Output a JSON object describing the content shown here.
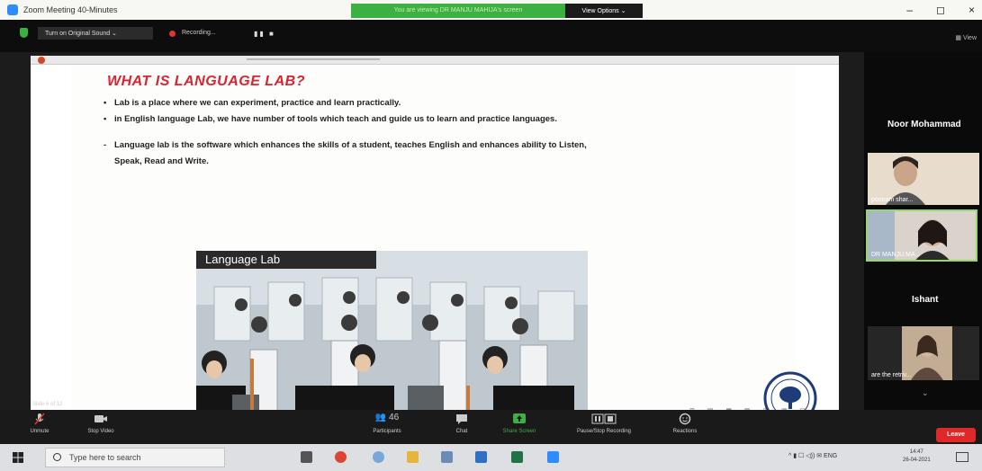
{
  "window": {
    "title": "Zoom Meeting 40-Minutes",
    "share_banner": "You are viewing DR MANJU MAHIJA's screen",
    "view_options": "View Options ⌄",
    "controls": [
      "–",
      "◻",
      "×"
    ]
  },
  "meeting_bar": {
    "original_sound": "Turn on Original Sound   ⌄",
    "recording": "Recording...",
    "pause_stop": "▮▮ ■",
    "view": "▦ View"
  },
  "slide": {
    "title": "WHAT IS LANGUAGE LAB?",
    "bullets": [
      "Lab is a place where we can experiment, practice and learn practically.",
      "in English language Lab, we have number of tools which teach and guide us to learn and practice languages.",
      "Language lab is the software which enhances the skills of a student, teaches English and enhances ability to Listen,",
      "Speak, Read and Write."
    ],
    "bullet_marks": [
      "•",
      "•",
      "-"
    ],
    "photo_caption": "Language Lab",
    "slide_count": "Slide 6 of 12",
    "seal_icon": "college-seal-icon"
  },
  "participants": {
    "top_name": "Noor Mohammad",
    "thumbs": [
      {
        "name": "poonam shar..."
      },
      {
        "name": "DR MANJU MA..."
      }
    ],
    "second_name": "Ishant",
    "third_thumb": {
      "name": "are the retriv..."
    }
  },
  "controls": {
    "unmute": "Unmute",
    "stop_video": "Stop Video",
    "participants": "Participants",
    "participant_count": "46",
    "chat": "Chat",
    "share_screen": "Share Screen",
    "pause_record": "Pause/Stop Recording",
    "reactions": "Reactions",
    "leave": "Leave"
  },
  "taskbar": {
    "search_placeholder": "Type here to search",
    "tray": "^  ▮  ☐  ◁))  ✉  ENG",
    "time": "14:47",
    "date": "26-04-2021"
  },
  "colors": {
    "accent_green": "#3cb043",
    "title_red": "#d8242f",
    "leave_red": "#e02828"
  }
}
